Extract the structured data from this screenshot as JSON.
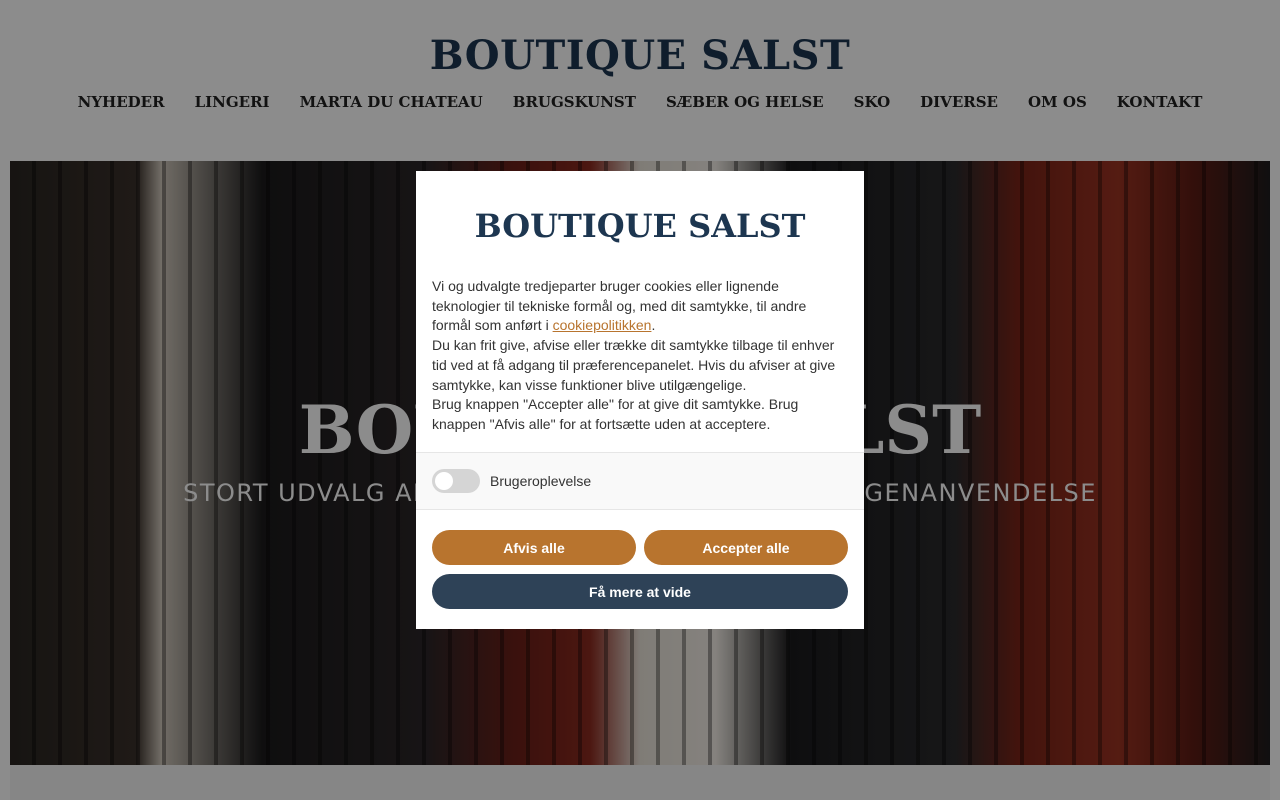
{
  "header": {
    "logo": "BOUTIQUE SALST",
    "nav": [
      "NYHEDER",
      "LINGERI",
      "MARTA DU CHATEAU",
      "BRUGSKUNST",
      "SÆBER OG HELSE",
      "SKO",
      "DIVERSE",
      "OM OS",
      "KONTAKT"
    ]
  },
  "hero": {
    "title": "BOUTIQUE SALST",
    "subtitle": "STORT UDVALG AF TØJ, LINGERI, BRUGSKUNST OG GENANVENDELSE"
  },
  "cookie": {
    "logo": "BOUTIQUE SALST",
    "p1_before": "Vi og udvalgte tredjeparter bruger cookies eller lignende teknologier til tekniske formål og, med dit samtykke, til andre formål som anført i ",
    "p1_link": "cookiepolitikken",
    "p1_after": ".",
    "p2": "Du kan frit give, afvise eller trække dit samtykke tilbage til enhver tid ved at få adgang til præferencepanelet. Hvis du afviser at give samtykke, kan visse funktioner blive utilgængelige.",
    "p3": "Brug knappen \"Accepter alle\" for at give dit samtykke. Brug knappen \"Afvis alle\" for at fortsætte uden at acceptere.",
    "toggle_label": "Brugeroplevelse",
    "toggle_on": false,
    "reject_label": "Afvis alle",
    "accept_label": "Accepter alle",
    "more_label": "Få mere at vide"
  },
  "colors": {
    "brand_navy": "#1d3650",
    "accent_orange": "#b8742e",
    "button_navy": "#2e4257"
  }
}
